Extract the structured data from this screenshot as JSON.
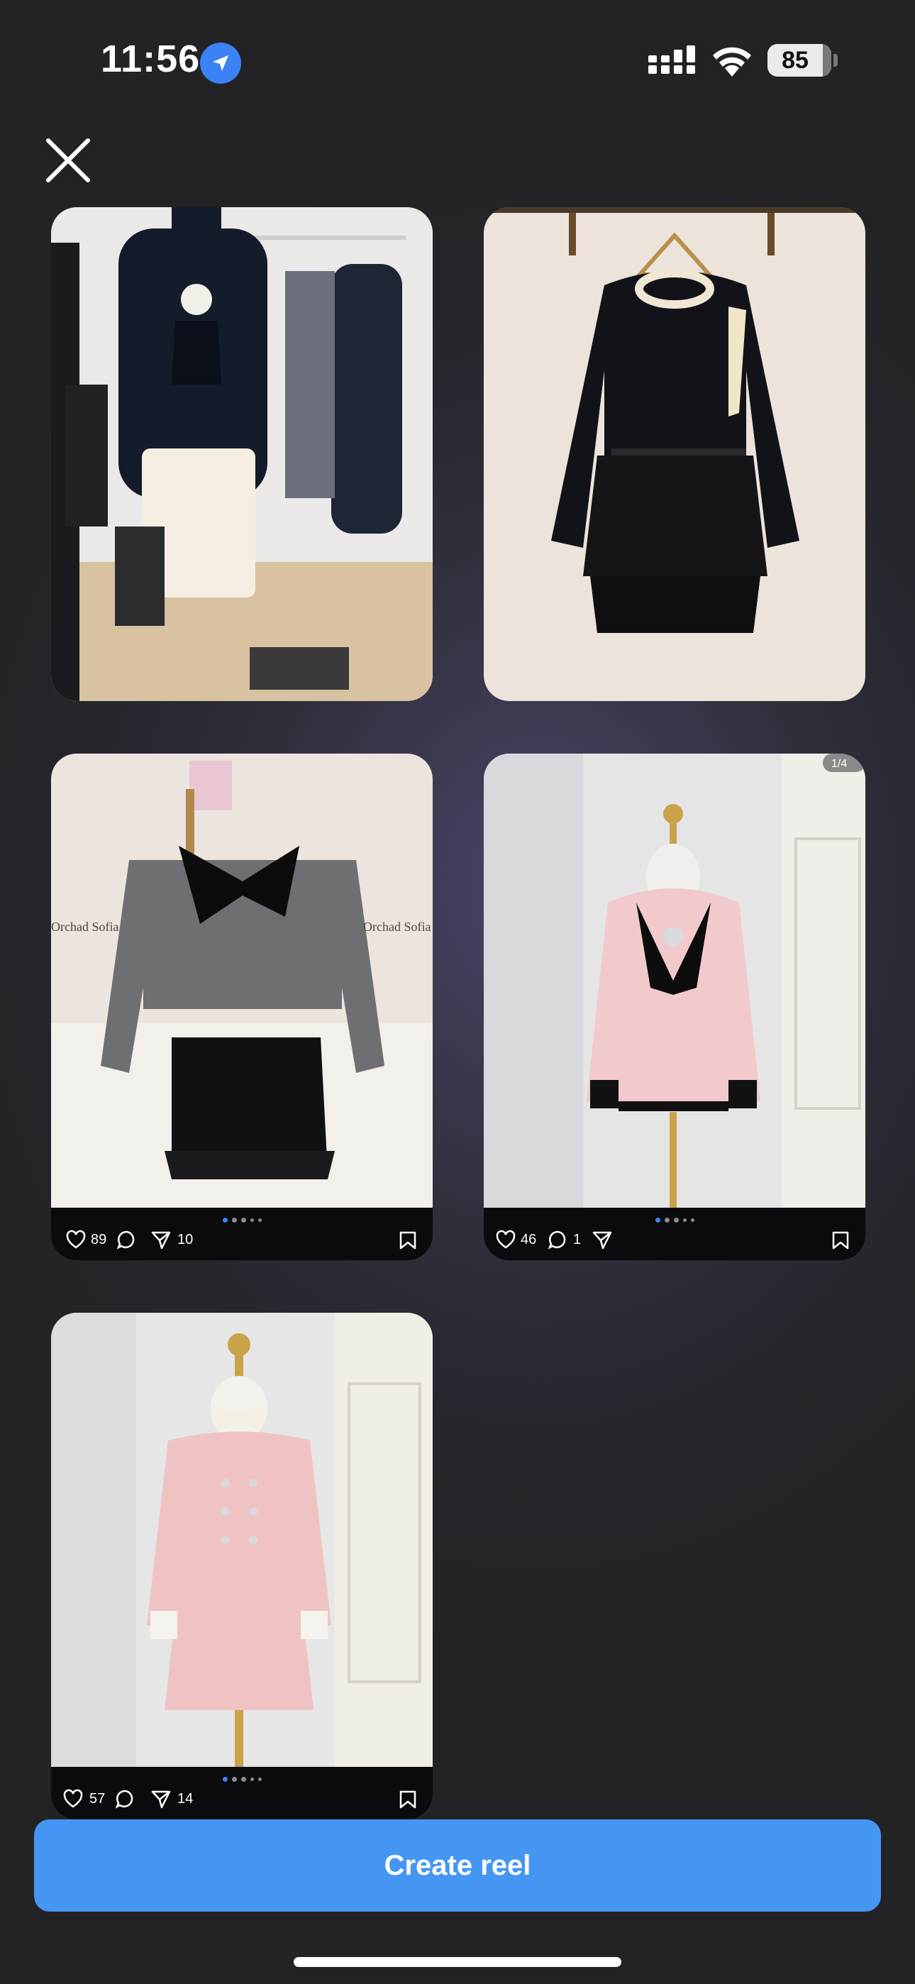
{
  "status_bar": {
    "time": "11:56",
    "battery": "85",
    "icons": [
      "location-arrow-icon",
      "cellular-signal-icon",
      "wifi-icon",
      "battery-icon"
    ]
  },
  "header": {
    "close_icon": "close-icon"
  },
  "posts": [
    {
      "id": "post-1",
      "image_desc": "black turtleneck vest with camellia brooch and white tweed skirt"
    },
    {
      "id": "post-2",
      "image_desc": "black sweater with cream bow and black pleated shorts"
    },
    {
      "id": "post-3",
      "watermark": "Orchad Sofia",
      "likes": "89",
      "comments": "",
      "shares": "10"
    },
    {
      "id": "post-4",
      "counter": "1/4",
      "likes": "46",
      "comments": "1",
      "shares": ""
    },
    {
      "id": "post-5",
      "likes": "57",
      "comments": "",
      "shares": "14"
    }
  ],
  "footer": {
    "create_button_label": "Create reel"
  },
  "colors": {
    "accent": "#4596f3",
    "dot_active": "#3b82f6",
    "background": "#25252b"
  }
}
